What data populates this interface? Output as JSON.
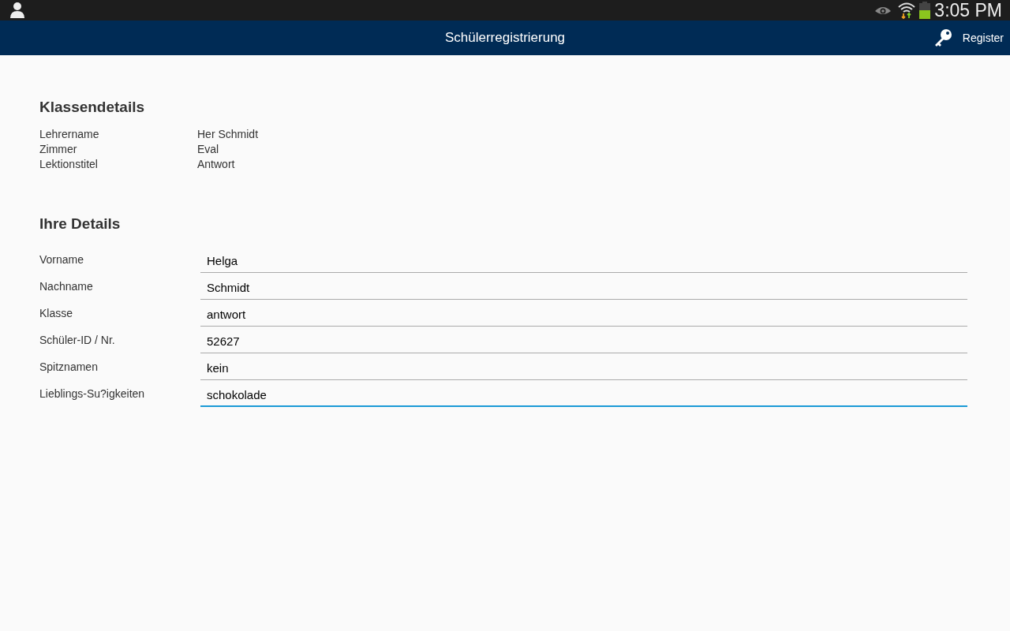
{
  "status_bar": {
    "time": "3:05 PM"
  },
  "action_bar": {
    "title": "Schülerregistrierung",
    "action": "Register"
  },
  "class_details": {
    "heading": "Klassendetails",
    "rows": [
      {
        "label": "Lehrername",
        "value": "Her Schmidt"
      },
      {
        "label": "Zimmer",
        "value": "Eval"
      },
      {
        "label": "Lektionstitel",
        "value": "Antwort"
      }
    ]
  },
  "your_details": {
    "heading": "Ihre Details",
    "fields": [
      {
        "label": "Vorname",
        "value": "Helga",
        "focused": false
      },
      {
        "label": "Nachname",
        "value": "Schmidt",
        "focused": false
      },
      {
        "label": "Klasse",
        "value": "antwort",
        "focused": false
      },
      {
        "label": "Schüler-ID / Nr.",
        "value": "52627",
        "focused": false
      },
      {
        "label": "Spitznamen",
        "value": "kein",
        "focused": false
      },
      {
        "label": "Lieblings-Su?igkeiten",
        "value": "schokolade",
        "focused": true
      }
    ]
  }
}
